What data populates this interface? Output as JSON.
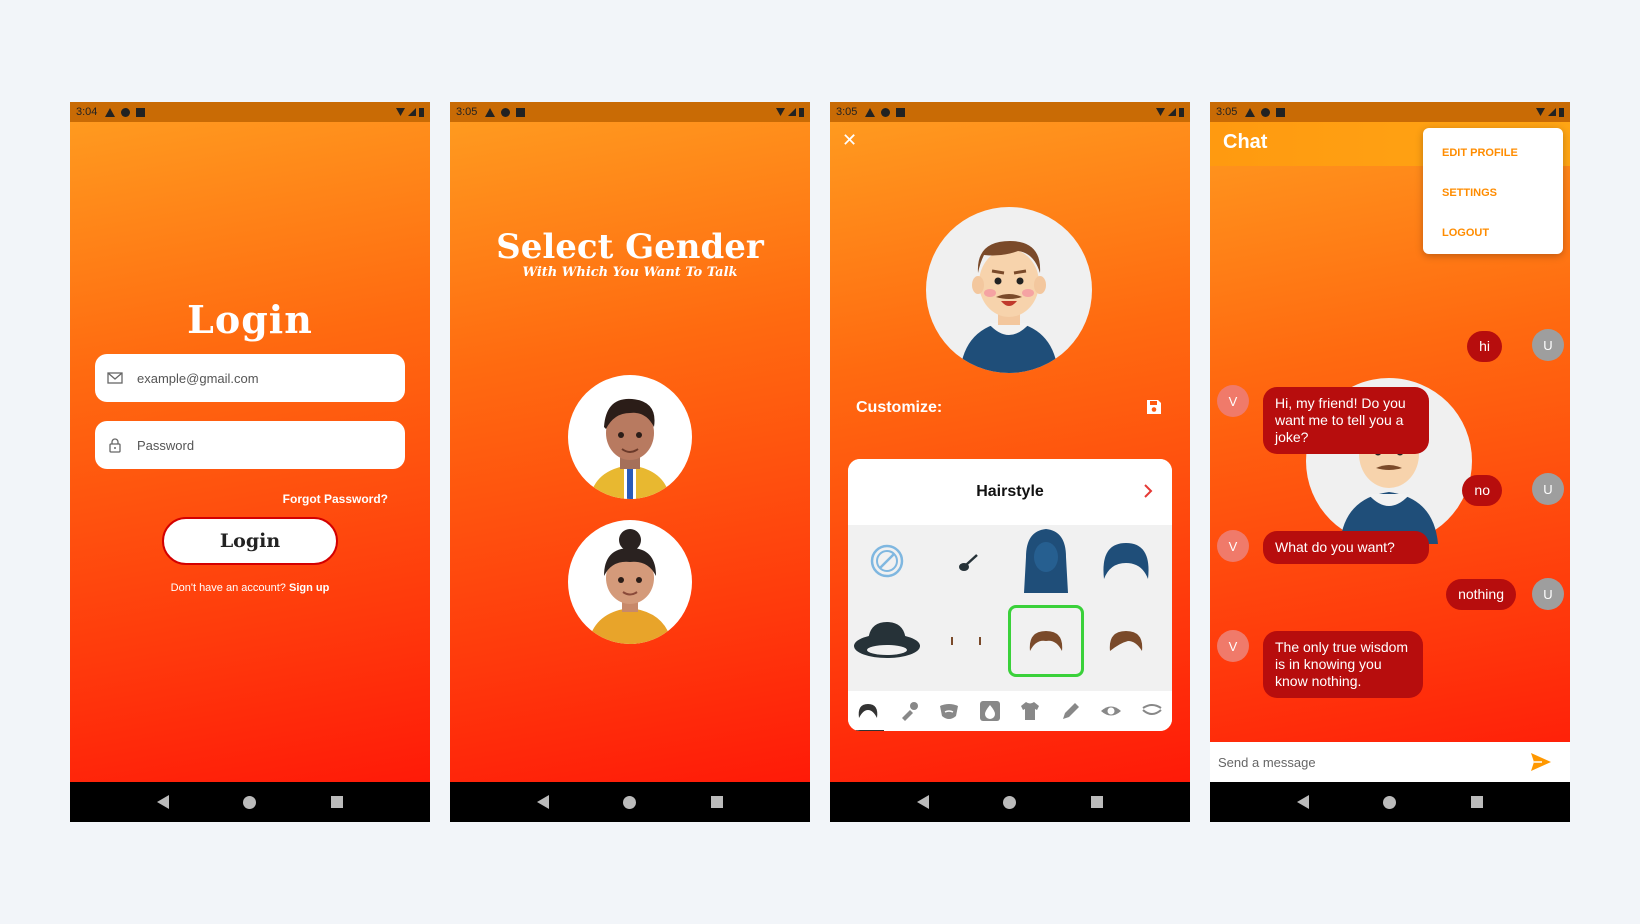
{
  "login_screen": {
    "status_time": "3:04",
    "title": "Login",
    "email_placeholder": "example@gmail.com",
    "password_placeholder": "Password",
    "forgot_password": "Forgot Password?",
    "login_button": "Login",
    "no_account_text": "Don't have an account?",
    "signup_link": "Sign up"
  },
  "gender_screen": {
    "status_time": "3:05",
    "title": "Select Gender",
    "subtitle": "With Which You Want To Talk"
  },
  "customize_screen": {
    "status_time": "3:05",
    "close_glyph": "✕",
    "customize_label": "Customize:",
    "panel_title": "Hairstyle",
    "selected_item_index": 6,
    "tab_icons": [
      "hair-icon",
      "brush-icon",
      "beard-icon",
      "drop-icon",
      "shirt-icon",
      "pen-icon",
      "eye-icon",
      "eyelash-icon"
    ]
  },
  "chat_screen": {
    "status_time": "3:05",
    "title": "Chat",
    "menu": [
      "EDIT PROFILE",
      "SETTINGS",
      "LOGOUT"
    ],
    "messages": [
      {
        "from": "U",
        "text": "hi"
      },
      {
        "from": "V",
        "text": "Hi, my friend! Do you want me to tell you a joke?"
      },
      {
        "from": "U",
        "text": "no"
      },
      {
        "from": "V",
        "text": "What do you want?"
      },
      {
        "from": "U",
        "text": "nothing"
      },
      {
        "from": "V",
        "text": "The only true wisdom is in knowing you know nothing."
      }
    ],
    "input_placeholder": "Send a message"
  },
  "colors": {
    "accent_orange": "#ff9a1f",
    "deep_red": "#b70d0d",
    "menu_text": "#ff8c00",
    "selection_green": "#3ad13a"
  }
}
